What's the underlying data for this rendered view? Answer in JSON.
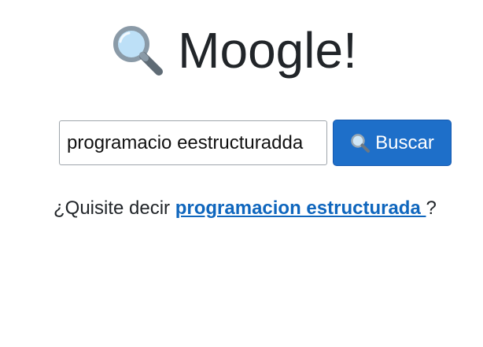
{
  "header": {
    "logo_icon": "magnifying-glass-icon",
    "title": "Moogle!"
  },
  "search": {
    "value": "programacio eestructuradda",
    "button_icon": "magnifying-glass-icon",
    "button_label": "Buscar"
  },
  "suggestion": {
    "prefix": "¿Quisite decir ",
    "link_text": "programacion estructurada ",
    "suffix": "?"
  },
  "colors": {
    "primary_button": "#1e6fc9",
    "link": "#0f66bd",
    "text": "#212529"
  }
}
